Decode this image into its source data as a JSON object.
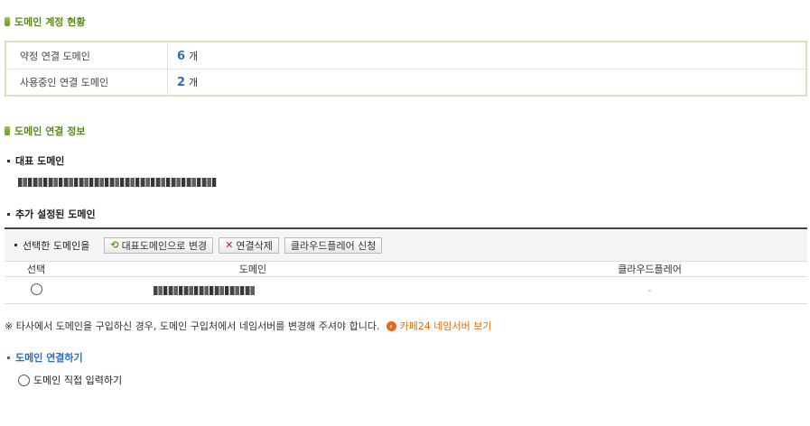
{
  "account_status": {
    "title": "도메인 계정 현황",
    "rows": [
      {
        "label": "약정 연결 도메인",
        "count": "6",
        "unit": "개"
      },
      {
        "label": "사용중인 연결 도메인",
        "count": "2",
        "unit": "개"
      }
    ]
  },
  "connection_info": {
    "title": "도메인 연결 정보",
    "primary_domain_label": "대표 도메인",
    "additional_domains_label": "추가 설정된 도메인",
    "toolbar": {
      "selected_label": "선택한 도메인을",
      "set_primary_button": "대표도메인으로 변경",
      "delete_button": "연결삭제",
      "cloudflare_button": "클라우드플레어 신청"
    },
    "table": {
      "headers": {
        "select": "선택",
        "domain": "도메인",
        "cloudflare": "클라우드플레어"
      },
      "rows": [
        {
          "cloudflare": "-"
        }
      ]
    }
  },
  "notice": {
    "text": "※ 타사에서 도메인을 구입하신 경우, 도메인 구입처에서 네임서버를 변경해 주셔야 합니다.",
    "link_text": "카페24 네임서버 보기"
  },
  "connect_domain": {
    "title": "도메인 연결하기",
    "option_label": "도메인 직접 입력하기"
  },
  "colors": {
    "section_green": "#5b8a1e",
    "count_blue": "#2a6fb8",
    "link_orange": "#e06d00",
    "box_border": "#d3e7b8"
  }
}
